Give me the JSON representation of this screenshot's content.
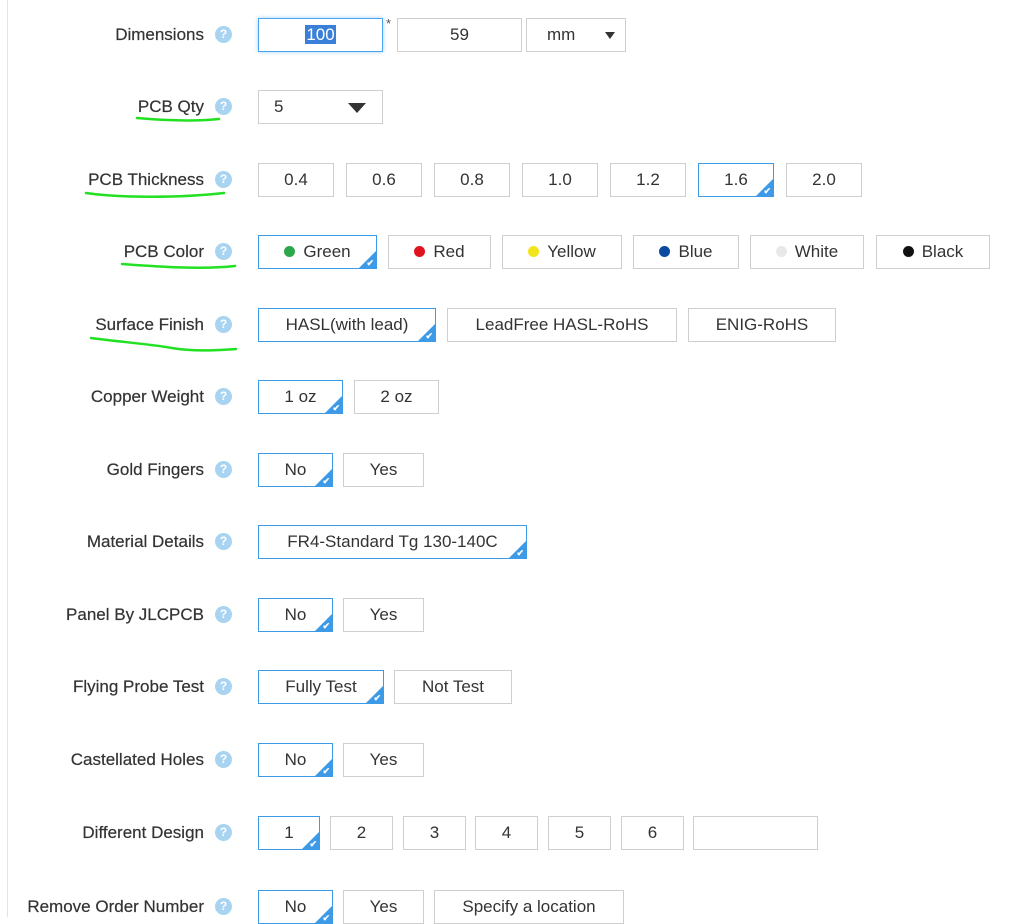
{
  "help_glyph": "?",
  "tick_glyph": "✔",
  "colors": {
    "accent": "#3c9ae6",
    "help": "#a9d4f1",
    "annotation": "#22e022"
  },
  "dimensions": {
    "label": "Dimensions",
    "width": "100",
    "separator": "*",
    "height": "59",
    "unit": "mm"
  },
  "pcb_qty": {
    "label": "PCB Qty",
    "value": "5"
  },
  "pcb_thickness": {
    "label": "PCB Thickness",
    "options": [
      "0.4",
      "0.6",
      "0.8",
      "1.0",
      "1.2",
      "1.6",
      "2.0"
    ],
    "selected": "1.6"
  },
  "pcb_color": {
    "label": "PCB Color",
    "options": [
      {
        "label": "Green",
        "color": "#2aa84a"
      },
      {
        "label": "Red",
        "color": "#e0141e"
      },
      {
        "label": "Yellow",
        "color": "#f3e51a"
      },
      {
        "label": "Blue",
        "color": "#0b4aa2"
      },
      {
        "label": "White",
        "color": "#e8e8e8"
      },
      {
        "label": "Black",
        "color": "#111111"
      }
    ],
    "selected": "Green"
  },
  "surface_finish": {
    "label": "Surface Finish",
    "options": [
      "HASL(with lead)",
      "LeadFree HASL-RoHS",
      "ENIG-RoHS"
    ],
    "selected": "HASL(with lead)"
  },
  "copper_weight": {
    "label": "Copper Weight",
    "options": [
      "1 oz",
      "2 oz"
    ],
    "selected": "1 oz"
  },
  "gold_fingers": {
    "label": "Gold Fingers",
    "options": [
      "No",
      "Yes"
    ],
    "selected": "No"
  },
  "material_details": {
    "label": "Material Details",
    "options": [
      "FR4-Standard Tg 130-140C"
    ],
    "selected": "FR4-Standard Tg 130-140C"
  },
  "panel_by_jlcpcb": {
    "label": "Panel By JLCPCB",
    "options": [
      "No",
      "Yes"
    ],
    "selected": "No"
  },
  "flying_probe_test": {
    "label": "Flying Probe Test",
    "options": [
      "Fully Test",
      "Not Test"
    ],
    "selected": "Fully Test"
  },
  "castellated_holes": {
    "label": "Castellated Holes",
    "options": [
      "No",
      "Yes"
    ],
    "selected": "No"
  },
  "different_design": {
    "label": "Different Design",
    "options": [
      "1",
      "2",
      "3",
      "4",
      "5",
      "6"
    ],
    "selected": "1",
    "custom_value": ""
  },
  "remove_order_number": {
    "label": "Remove Order Number",
    "options": [
      "No",
      "Yes",
      "Specify a location"
    ],
    "selected": "No"
  }
}
